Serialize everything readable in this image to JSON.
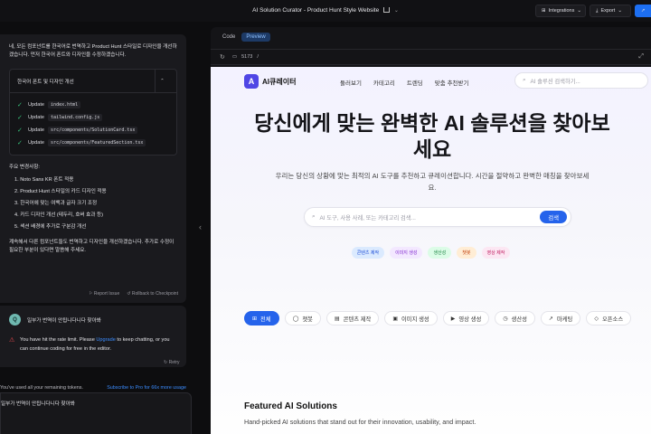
{
  "app": {
    "title": "AI Solution Curator - Product Hunt Style Website",
    "integrations_label": "Integrations",
    "export_label": "Export"
  },
  "chat": {
    "assistant_intro": "네, 모든 컴포넌트를 한국어로 번역하고 Product Hunt 스타일로 디자인을 개선하겠습니다. 먼저 한국어 폰트와 디자인을 수정하겠습니다.",
    "artifact": {
      "title": "한국어 폰트 및 디자인 개선",
      "actions": [
        {
          "verb": "Update",
          "file": "index.html"
        },
        {
          "verb": "Update",
          "file": "tailwind.config.js"
        },
        {
          "verb": "Update",
          "file": "src/components/SolutionCard.tsx"
        },
        {
          "verb": "Update",
          "file": "src/components/FeaturedSection.tsx"
        }
      ]
    },
    "changes_heading": "주요 변경사항:",
    "changes": [
      "1. Noto Sans KR 폰트 적용",
      "2. Product Hunt 스타일의 카드 디자인 적용",
      "3. 한국어에 맞는 여백과 글자 크기 조정",
      "4. 카드 디자인 개선 (테두리, 호버 효과 등)",
      "5. 섹션 배경에 추가로 구분감 개선"
    ],
    "outro": "계속해서 다른 컴포넌트들도 번역하고 디자인을 개선하겠습니다. 추가로 수정이 필요한 부분이 있다면 말씀해 주세요.",
    "report_issue": "Report Issue",
    "rollback": "Rollback to Checkpoint",
    "user_avatar": "Q",
    "user_message": "일부가 번역이 안됩니다니다 찾아봐",
    "rate_limit_prefix": "You have hit the rate limit. Please ",
    "rate_limit_link": "Upgrade",
    "rate_limit_suffix": " to keep chatting, or you can continue coding for free in the editor.",
    "retry": "Retry",
    "tokens_notice": "You've used all your remaining tokens.",
    "subscribe_link": "Subscribe to Pro for 66x more usage",
    "input_value": "일부가 번역이 안됩니다니다 찾아봐"
  },
  "preview": {
    "tab_code": "Code",
    "tab_preview": "Preview",
    "port": "5173",
    "path": "/"
  },
  "site": {
    "logo_mark": "A",
    "logo_text": "AI큐레이터",
    "nav": [
      "둘러보기",
      "카테고리",
      "트렌딩",
      "맞춤 추천받기"
    ],
    "nav_search_placeholder": "AI 솔루션 검색하기...",
    "hero_title": "당신에게 맞는 완벽한 AI 솔루션을 찾아보세요",
    "hero_subtitle": "우리는 당신의 상황에 맞는 최적의 AI 도구를 추천하고 큐레이션합니다. 시간을 절약하고 완벽한 매칭을 찾아보세요.",
    "hero_search_placeholder": "AI 도구, 사용 사례, 또는 카테고리 검색...",
    "hero_search_button": "검색",
    "tag_pills": [
      {
        "label": "콘텐츠 제작",
        "bg": "#dbeafe",
        "fg": "#1d4ed8"
      },
      {
        "label": "이미지 생성",
        "bg": "#f3e8ff",
        "fg": "#7e22ce"
      },
      {
        "label": "생산성",
        "bg": "#dcfce7",
        "fg": "#15803d"
      },
      {
        "label": "챗봇",
        "bg": "#ffedd5",
        "fg": "#c2410c"
      },
      {
        "label": "영상 제작",
        "bg": "#fce7f3",
        "fg": "#be185d"
      }
    ],
    "filters": [
      {
        "label": "전체",
        "icon": "⊞"
      },
      {
        "label": "챗봇",
        "icon": "◯"
      },
      {
        "label": "콘텐츠 제작",
        "icon": "▤"
      },
      {
        "label": "이미지 생성",
        "icon": "▣"
      },
      {
        "label": "영상 생성",
        "icon": "▶"
      },
      {
        "label": "생산성",
        "icon": "◷"
      },
      {
        "label": "마케팅",
        "icon": "↗"
      },
      {
        "label": "오픈소스",
        "icon": "◇"
      }
    ],
    "featured_title": "Featured AI Solutions",
    "featured_subtitle": "Hand-picked AI solutions that stand out for their innovation, usability, and impact."
  },
  "colors": {
    "accent": "#2563eb",
    "logo": "#4f46e5",
    "success": "#37c27a",
    "error": "#e5484d"
  }
}
